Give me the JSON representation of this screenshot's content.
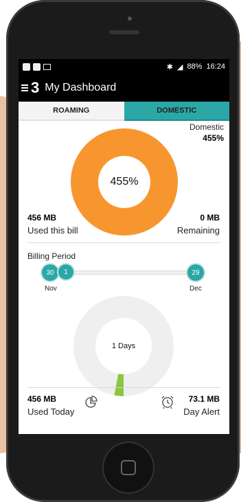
{
  "status_bar": {
    "battery": "88%",
    "time": "16:24",
    "icons": [
      "notification-square-icon",
      "notification-square-icon",
      "image-icon",
      "bluetooth-icon",
      "lte-signal-icon"
    ]
  },
  "app": {
    "title": "My Dashboard",
    "logo": "3"
  },
  "tabs": [
    {
      "label": "ROAMING",
      "active": false
    },
    {
      "label": "DOMESTIC",
      "active": true
    }
  ],
  "usage": {
    "plan_label": "Domestic",
    "plan_percent": "455%",
    "center_percent": "455%",
    "used_value": "456 MB",
    "used_label": "Used this bill",
    "remaining_value": "0 MB",
    "remaining_label": "Remaining",
    "colors": {
      "usage_ring": "#f7962f",
      "accent": "#2ba7a7"
    }
  },
  "billing": {
    "title": "Billing Period",
    "start_day": "30",
    "start_month": "Nov",
    "current_day": "1",
    "end_day": "29",
    "end_month": "Dec",
    "progress_fraction": 0.03,
    "day_ring_label": "1 Days",
    "colors": {
      "ring": "#efefef",
      "progress": "#8cc63f"
    }
  },
  "daily": {
    "used_today_value": "456 MB",
    "used_today_label": "Used Today",
    "alert_value": "73.1 MB",
    "alert_label": "Day Alert"
  }
}
